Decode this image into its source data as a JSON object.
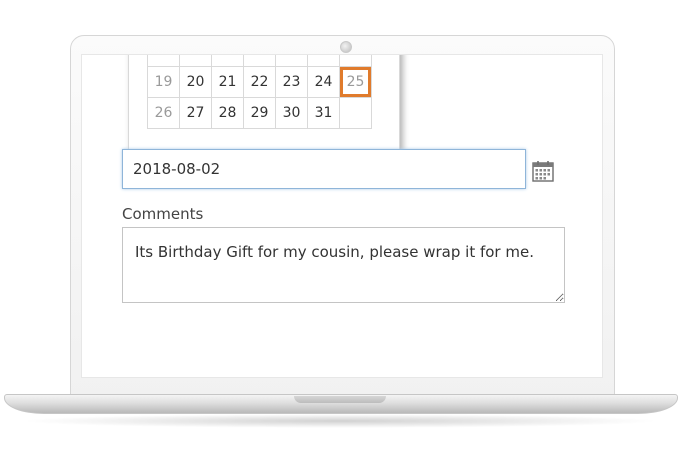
{
  "calendar": {
    "rows": [
      [
        "",
        "",
        "",
        "",
        "",
        "",
        ""
      ],
      [
        "19",
        "20",
        "21",
        "22",
        "23",
        "24",
        "25"
      ],
      [
        "26",
        "27",
        "28",
        "29",
        "30",
        "31",
        ""
      ]
    ],
    "highlighted_day": "25",
    "highlight_color": "#e07b2c"
  },
  "date_field": {
    "value": "2018-08-02",
    "icon": "calendar-icon"
  },
  "comments": {
    "label": "Comments",
    "value": "Its Birthday Gift for my cousin, please wrap it for me."
  },
  "colors": {
    "focus_border": "#8fb5d9",
    "muted_day": "#9a9a9a",
    "text": "#333333"
  }
}
